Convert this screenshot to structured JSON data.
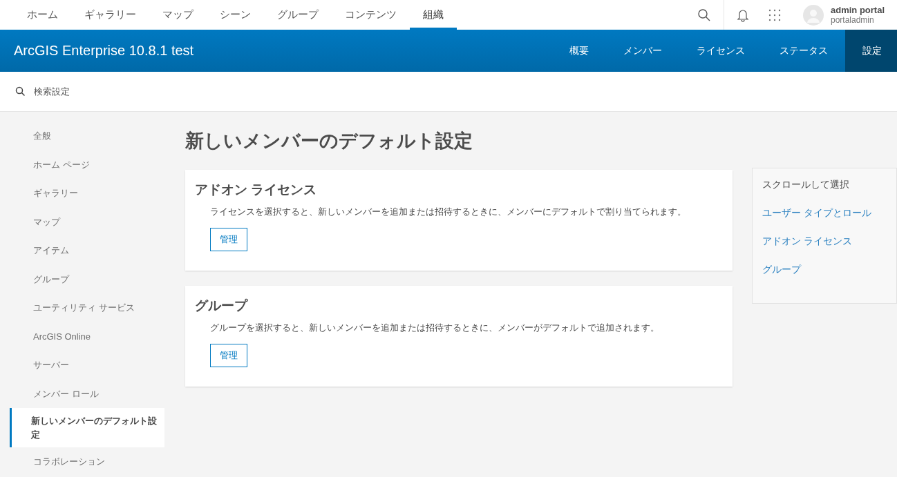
{
  "top_nav": {
    "items": [
      {
        "label": "ホーム",
        "selected": false
      },
      {
        "label": "ギャラリー",
        "selected": false
      },
      {
        "label": "マップ",
        "selected": false
      },
      {
        "label": "シーン",
        "selected": false
      },
      {
        "label": "グループ",
        "selected": false
      },
      {
        "label": "コンテンツ",
        "selected": false
      },
      {
        "label": "組織",
        "selected": true
      }
    ],
    "user": {
      "name": "admin portal",
      "username": "portaladmin"
    }
  },
  "org_bar": {
    "title": "ArcGIS Enterprise 10.8.1 test",
    "tabs": [
      {
        "label": "概要",
        "selected": false
      },
      {
        "label": "メンバー",
        "selected": false
      },
      {
        "label": "ライセンス",
        "selected": false
      },
      {
        "label": "ステータス",
        "selected": false
      },
      {
        "label": "設定",
        "selected": true
      }
    ]
  },
  "search": {
    "placeholder": "検索設定"
  },
  "sidebar": {
    "items": [
      {
        "label": "全般",
        "selected": false
      },
      {
        "label": "ホーム ページ",
        "selected": false
      },
      {
        "label": "ギャラリー",
        "selected": false
      },
      {
        "label": "マップ",
        "selected": false
      },
      {
        "label": "アイテム",
        "selected": false
      },
      {
        "label": "グループ",
        "selected": false
      },
      {
        "label": "ユーティリティ サービス",
        "selected": false
      },
      {
        "label": "ArcGIS Online",
        "selected": false
      },
      {
        "label": "サーバー",
        "selected": false
      },
      {
        "label": "メンバー ロール",
        "selected": false
      },
      {
        "label": "新しいメンバーのデフォルト設定",
        "selected": true
      },
      {
        "label": "コラボレーション",
        "selected": false
      }
    ]
  },
  "page_title": "新しいメンバーのデフォルト設定",
  "sections": [
    {
      "title": "アドオン ライセンス",
      "description": "ライセンスを選択すると、新しいメンバーを追加または招待するときに、メンバーにデフォルトで割り当てられます。",
      "button": "管理"
    },
    {
      "title": "グループ",
      "description": "グループを選択すると、新しいメンバーを追加または招待するときに、メンバーがデフォルトで追加されます。",
      "button": "管理"
    }
  ],
  "scroll_panel": {
    "heading": "スクロールして選択",
    "links": [
      "ユーザー タイプとロール",
      "アドオン ライセンス",
      "グループ"
    ]
  }
}
